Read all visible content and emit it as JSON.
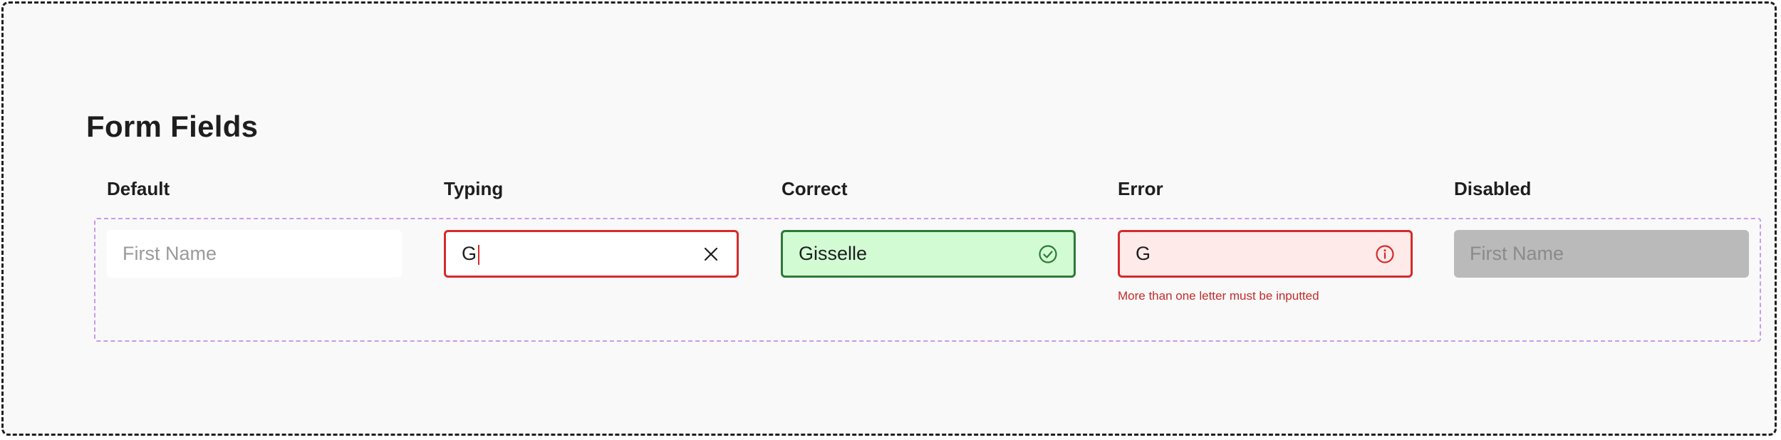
{
  "page": {
    "title": "Form Fields"
  },
  "columns": [
    {
      "label": "Default"
    },
    {
      "label": "Typing"
    },
    {
      "label": "Correct"
    },
    {
      "label": "Error"
    },
    {
      "label": "Disabled"
    }
  ],
  "fields": {
    "default": {
      "placeholder": "First Name",
      "value": ""
    },
    "typing": {
      "value": "G",
      "icon": "close-icon"
    },
    "correct": {
      "value": "Gisselle",
      "icon": "check-circle-icon"
    },
    "error": {
      "value": "G",
      "icon": "info-circle-icon",
      "message": "More than one letter must be inputted"
    },
    "disabled": {
      "placeholder": "First Name",
      "value": ""
    }
  },
  "colors": {
    "error": "#d42b2b",
    "success": "#2c7a36",
    "success_bg": "#d2fbd4",
    "error_bg": "#ffeaea",
    "disabled_bg": "#bababa",
    "component_outline": "#c89af0"
  }
}
